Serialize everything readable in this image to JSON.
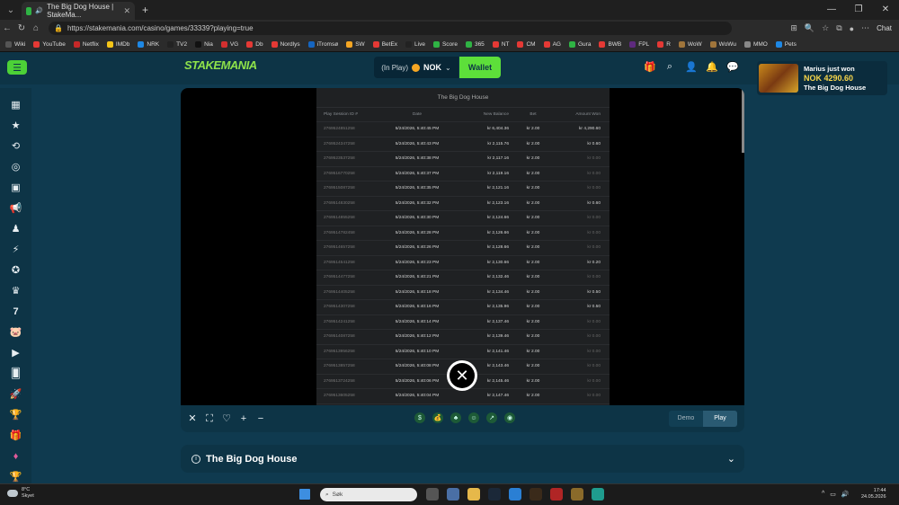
{
  "browser": {
    "tab_title": "The Big Dog House | StakeMa...",
    "url": "https://stakemania.com/casino/games/33339?playing=true",
    "chat_label": "Chat"
  },
  "bookmarks": [
    {
      "label": "Wiki",
      "color": "#555555"
    },
    {
      "label": "YouTube",
      "color": "#e53935"
    },
    {
      "label": "Netflix",
      "color": "#c62828"
    },
    {
      "label": "IMDb",
      "color": "#f5c518"
    },
    {
      "label": "NRK",
      "color": "#1e88e5"
    },
    {
      "label": "TV2",
      "color": "#222222"
    },
    {
      "label": "Nia",
      "color": "#111111"
    },
    {
      "label": "VG",
      "color": "#d32f2f"
    },
    {
      "label": "Db",
      "color": "#e53935"
    },
    {
      "label": "Nordlys",
      "color": "#e53935"
    },
    {
      "label": "iTromsø",
      "color": "#1565c0"
    },
    {
      "label": "SW",
      "color": "#f5a623"
    },
    {
      "label": "BetEx",
      "color": "#e53935"
    },
    {
      "label": "Live",
      "color": "#222222"
    },
    {
      "label": "Score",
      "color": "#2fb344"
    },
    {
      "label": "365",
      "color": "#2fb344"
    },
    {
      "label": "NT",
      "color": "#e53935"
    },
    {
      "label": "CM",
      "color": "#e53935"
    },
    {
      "label": "AG",
      "color": "#e53935"
    },
    {
      "label": "Gura",
      "color": "#2fb344"
    },
    {
      "label": "BWB",
      "color": "#e53935"
    },
    {
      "label": "FPL",
      "color": "#5e2a7e"
    },
    {
      "label": "R",
      "color": "#e53935"
    },
    {
      "label": "WoW",
      "color": "#a0753b"
    },
    {
      "label": "WoWu",
      "color": "#a0753b"
    },
    {
      "label": "MMO",
      "color": "#888888"
    },
    {
      "label": "Pets",
      "color": "#1e88e5"
    }
  ],
  "header": {
    "logo": "STAKEMANIA",
    "in_play": "(In Play)",
    "currency": "NOK",
    "wallet_label": "Wallet"
  },
  "winner": {
    "line1": "Marius just won",
    "amount": "NOK 4290.60",
    "game": "The Big Dog House"
  },
  "history": {
    "title": "The Big Dog House",
    "columns": [
      "Play Session ID #",
      "Date",
      "New Balance",
      "Bet",
      "Amount Won"
    ],
    "rows": [
      [
        "2769524851258",
        "5/24/2026, 5:40:45 PM",
        "kr 6,404.36",
        "kr 2.00",
        "kr 4,290.60"
      ],
      [
        "2769524347258",
        "5/24/2026, 5:40:43 PM",
        "kr 2,115.76",
        "kr 2.00",
        "kr 0.60"
      ],
      [
        "2769523537258",
        "5/24/2026, 5:40:38 PM",
        "kr 2,117.16",
        "kr 2.00",
        "kr 0.00"
      ],
      [
        "2769516770258",
        "5/24/2026, 5:40:37 PM",
        "kr 2,119.16",
        "kr 2.00",
        "kr 0.00"
      ],
      [
        "2769515087258",
        "5/24/2026, 5:40:35 PM",
        "kr 2,121.16",
        "kr 2.00",
        "kr 0.00"
      ],
      [
        "2769514830258",
        "5/24/2026, 5:40:32 PM",
        "kr 2,123.16",
        "kr 2.00",
        "kr 0.60"
      ],
      [
        "2769514855258",
        "5/24/2026, 5:40:30 PM",
        "kr 2,124.66",
        "kr 2.00",
        "kr 0.00"
      ],
      [
        "2769514782458",
        "5/24/2026, 5:40:28 PM",
        "kr 2,126.66",
        "kr 2.00",
        "kr 0.00"
      ],
      [
        "2769514657258",
        "5/24/2026, 5:40:26 PM",
        "kr 2,128.66",
        "kr 2.00",
        "kr 0.00"
      ],
      [
        "2769514541258",
        "5/24/2026, 5:40:23 PM",
        "kr 2,130.66",
        "kr 2.00",
        "kr 0.20"
      ],
      [
        "2769514477258",
        "5/24/2026, 5:40:21 PM",
        "kr 2,132.46",
        "kr 2.00",
        "kr 0.00"
      ],
      [
        "2769514405258",
        "5/24/2026, 5:40:18 PM",
        "kr 2,134.46",
        "kr 2.00",
        "kr 0.50"
      ],
      [
        "2769514307258",
        "5/24/2026, 5:40:16 PM",
        "kr 2,135.96",
        "kr 2.00",
        "kr 0.50"
      ],
      [
        "2769514241258",
        "5/24/2026, 5:40:14 PM",
        "kr 2,137.46",
        "kr 2.00",
        "kr 0.00"
      ],
      [
        "2769514087258",
        "5/24/2026, 5:40:12 PM",
        "kr 2,139.46",
        "kr 2.00",
        "kr 0.00"
      ],
      [
        "2769513956258",
        "5/24/2026, 5:40:10 PM",
        "kr 2,141.46",
        "kr 2.00",
        "kr 0.00"
      ],
      [
        "2769513857258",
        "5/24/2026, 5:40:08 PM",
        "kr 2,143.46",
        "kr 2.00",
        "kr 0.00"
      ],
      [
        "2769513724258",
        "5/24/2026, 5:40:06 PM",
        "kr 2,145.46",
        "kr 2.00",
        "kr 0.00"
      ],
      [
        "2769513605258",
        "5/24/2026, 5:40:04 PM",
        "kr 2,147.46",
        "kr 2.00",
        "kr 0.00"
      ]
    ]
  },
  "game": {
    "demo_label": "Demo",
    "play_label": "Play",
    "title": "The Big Dog House"
  },
  "taskbar": {
    "temp": "8°C",
    "condition": "Skyet",
    "search_placeholder": "Søk",
    "time": "17:44",
    "date": "24.05.2026"
  }
}
